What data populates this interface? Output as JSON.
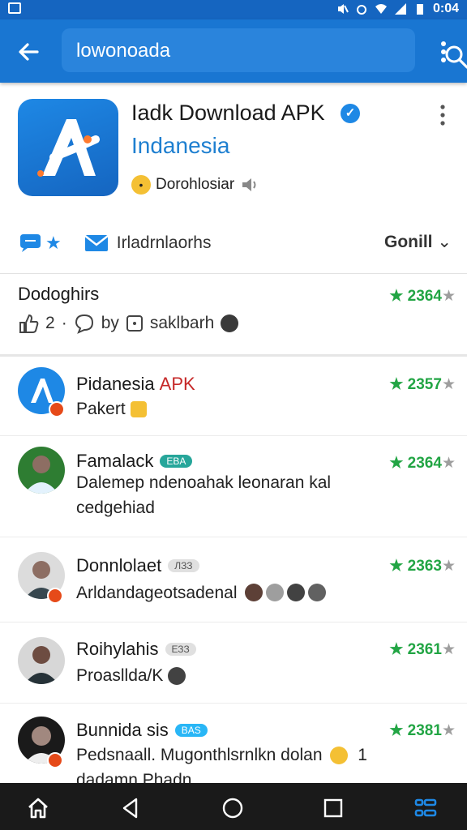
{
  "status_bar": {
    "time": "0:04"
  },
  "toolbar": {
    "search_value": "lowonoada"
  },
  "app": {
    "title": "Iadk Download APK",
    "subtitle": "Indanesia",
    "developer": "Dorohlosiar",
    "tag_label": "Irladrnlaorhs",
    "sort_label": "Gonill"
  },
  "summary": {
    "title": "Dodoghirs",
    "likes": "2",
    "by_label": "by",
    "author": "saklbarh",
    "rating": "2364"
  },
  "comments": [
    {
      "name": "Pidanesia",
      "name_accent": "APK",
      "badge": "",
      "body": "Pakert",
      "rating": "2357"
    },
    {
      "name": "Famalack",
      "name_accent": "",
      "badge": "EBA",
      "body": "Dalemep ndenoahak leonaran kal cedgehiad",
      "rating": "2364"
    },
    {
      "name": "Donnlolaet",
      "name_accent": "",
      "badge": "ЛЗЗ",
      "body": "Arldandageotsadenal",
      "rating": "2363"
    },
    {
      "name": "Roihylahis",
      "name_accent": "",
      "badge": "ЕЗЗ",
      "body": "Proasllda/K",
      "rating": "2361"
    },
    {
      "name": "Bunnida sis",
      "name_accent": "",
      "badge": "BAS",
      "body": "Pedsnaall. Mugonthlsrnlkn dolan",
      "body_tail": "1",
      "body2": "dadamn Phadn",
      "rating": "2381"
    }
  ],
  "colors": {
    "toolbar": "#1976d2",
    "status_bar": "#1565c0",
    "accent_link": "#1e7fd0",
    "rating_green": "#22a544",
    "nav_bar": "#1a1a1a"
  }
}
